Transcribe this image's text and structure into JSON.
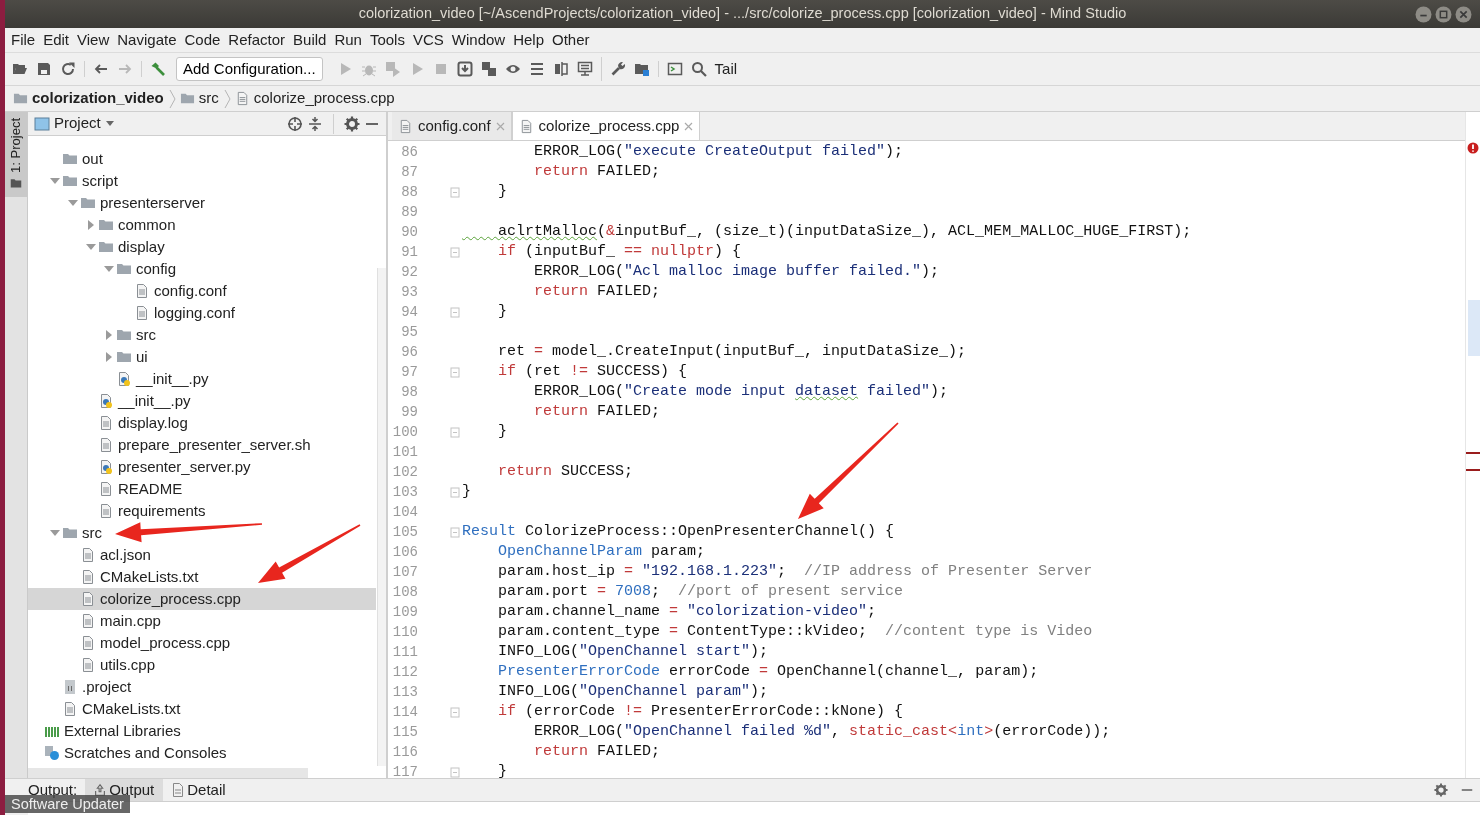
{
  "window": {
    "title": "colorization_video [~/AscendProjects/colorization_video] - .../src/colorize_process.cpp [colorization_video] - Mind Studio"
  },
  "menu": [
    "File",
    "Edit",
    "View",
    "Navigate",
    "Code",
    "Refactor",
    "Build",
    "Run",
    "Tools",
    "VCS",
    "Window",
    "Help",
    "Other"
  ],
  "toolbar": [
    [
      {
        "kind": "open",
        "disabled": false
      },
      {
        "kind": "save",
        "disabled": false
      },
      {
        "kind": "sync",
        "disabled": false
      }
    ],
    [
      {
        "kind": "back",
        "disabled": false
      },
      {
        "kind": "forward",
        "disabled": true
      }
    ],
    [
      {
        "kind": "build",
        "disabled": false
      },
      {
        "kind": "config",
        "label": "Add Configuration...",
        "disabled": false
      },
      {
        "kind": "run",
        "disabled": true
      },
      {
        "kind": "debug",
        "disabled": true
      },
      {
        "kind": "coverage",
        "disabled": true
      },
      {
        "kind": "run",
        "disabled": true
      },
      {
        "kind": "stop",
        "disabled": true
      },
      {
        "kind": "download",
        "disabled": false
      },
      {
        "kind": "squares",
        "disabled": false
      },
      {
        "kind": "eye",
        "disabled": false
      },
      {
        "kind": "list",
        "disabled": false
      },
      {
        "kind": "split",
        "disabled": false
      },
      {
        "kind": "monitor",
        "disabled": false
      }
    ],
    [
      {
        "kind": "wrench",
        "disabled": false
      },
      {
        "kind": "foldergrid",
        "disabled": false
      }
    ],
    [
      {
        "kind": "terminal",
        "disabled": false
      },
      {
        "kind": "search",
        "disabled": false
      },
      {
        "kind": "text",
        "label": "Tail",
        "disabled": false
      }
    ]
  ],
  "breadcrumb": [
    {
      "label": "colorization_video",
      "kind": "project"
    },
    {
      "label": "src",
      "kind": "folder"
    },
    {
      "label": "colorize_process.cpp",
      "kind": "file"
    }
  ],
  "side_tabs": [
    {
      "label": "1: Project",
      "selected": true
    }
  ],
  "project_panel": {
    "title": "Project",
    "tree": {
      "items": [
        {
          "label": "out",
          "kind": "folder",
          "selected": false
        },
        {
          "label": "script",
          "kind": "folder",
          "expanded": true,
          "selected": false,
          "children": [
            {
              "label": "presenterserver",
              "kind": "folder",
              "expanded": true,
              "selected": false,
              "children": [
                {
                  "label": "common",
                  "kind": "folder",
                  "expanded": false,
                  "selected": false
                },
                {
                  "label": "display",
                  "kind": "folder",
                  "expanded": true,
                  "selected": false,
                  "children": [
                    {
                      "label": "config",
                      "kind": "folder",
                      "expanded": true,
                      "selected": false,
                      "children": [
                        {
                          "label": "config.conf",
                          "kind": "file",
                          "selected": false
                        },
                        {
                          "label": "logging.conf",
                          "kind": "file",
                          "selected": false
                        }
                      ]
                    },
                    {
                      "label": "src",
                      "kind": "folder",
                      "expanded": false,
                      "selected": false
                    },
                    {
                      "label": "ui",
                      "kind": "folder",
                      "expanded": false,
                      "selected": false
                    },
                    {
                      "label": "__init__.py",
                      "kind": "python",
                      "selected": false
                    }
                  ]
                },
                {
                  "label": "__init__.py",
                  "kind": "python",
                  "selected": false
                },
                {
                  "label": "display.log",
                  "kind": "file",
                  "selected": false
                },
                {
                  "label": "prepare_presenter_server.sh",
                  "kind": "file",
                  "selected": false
                },
                {
                  "label": "presenter_server.py",
                  "kind": "python",
                  "selected": false
                },
                {
                  "label": "README",
                  "kind": "file",
                  "selected": false
                },
                {
                  "label": "requirements",
                  "kind": "file",
                  "selected": false
                }
              ]
            }
          ]
        },
        {
          "label": "src",
          "kind": "folder",
          "expanded": true,
          "selected": false,
          "children": [
            {
              "label": "acl.json",
              "kind": "file",
              "selected": false
            },
            {
              "label": "CMakeLists.txt",
              "kind": "file",
              "selected": false
            },
            {
              "label": "colorize_process.cpp",
              "kind": "file",
              "selected": true
            },
            {
              "label": "main.cpp",
              "kind": "file",
              "selected": false
            },
            {
              "label": "model_process.cpp",
              "kind": "file",
              "selected": false
            },
            {
              "label": "utils.cpp",
              "kind": "file",
              "selected": false
            }
          ]
        },
        {
          "label": ".project",
          "kind": "project",
          "selected": false
        },
        {
          "label": "CMakeLists.txt",
          "kind": "file",
          "selected": false
        }
      ],
      "roots": [
        {
          "label": "External Libraries",
          "kind": "libraries",
          "selected": false
        },
        {
          "label": "Scratches and Consoles",
          "kind": "scratches",
          "selected": false
        }
      ]
    }
  },
  "editor_tabs": [
    {
      "label": "config.conf",
      "selected": false
    },
    {
      "label": "colorize_process.cpp",
      "selected": true
    }
  ],
  "code": [
    {
      "number": "86",
      "fold": false,
      "segments": [
        {
          "kind": "plain",
          "text": "        ERROR_LOG("
        },
        {
          "kind": "string",
          "text": "\"execute CreateOutput failed\""
        },
        {
          "kind": "plain",
          "text": ");"
        }
      ]
    },
    {
      "number": "87",
      "fold": false,
      "segments": [
        {
          "kind": "keyword",
          "text": "        return"
        },
        {
          "kind": "plain",
          "text": " FAILED;"
        }
      ]
    },
    {
      "number": "88",
      "fold": true,
      "segments": [
        {
          "kind": "plain",
          "text": "    }"
        }
      ]
    },
    {
      "number": "89",
      "fold": false
    },
    {
      "number": "90",
      "fold": false,
      "segments": [
        {
          "kind": "spell",
          "text": "    aclrtMalloc"
        },
        {
          "kind": "plain",
          "text": "("
        },
        {
          "kind": "keyword",
          "text": "&"
        },
        {
          "kind": "plain",
          "text": "inputBuf_, (size_t)(inputDataSize_), ACL_MEM_MALLOC_HUGE_FIRST);"
        }
      ]
    },
    {
      "number": "91",
      "fold": true,
      "segments": [
        {
          "kind": "keyword",
          "text": "    if"
        },
        {
          "kind": "plain",
          "text": " (inputBuf_ "
        },
        {
          "kind": "keyword",
          "text": "== nullptr"
        },
        {
          "kind": "plain",
          "text": ") {"
        }
      ]
    },
    {
      "number": "92",
      "fold": false,
      "segments": [
        {
          "kind": "plain",
          "text": "        ERROR_LOG("
        },
        {
          "kind": "string",
          "text": "\"Acl malloc image buffer failed.\""
        },
        {
          "kind": "plain",
          "text": ");"
        }
      ]
    },
    {
      "number": "93",
      "fold": false,
      "segments": [
        {
          "kind": "keyword",
          "text": "        return"
        },
        {
          "kind": "plain",
          "text": " FAILED;"
        }
      ]
    },
    {
      "number": "94",
      "fold": true,
      "segments": [
        {
          "kind": "plain",
          "text": "    }"
        }
      ]
    },
    {
      "number": "95",
      "fold": false
    },
    {
      "number": "96",
      "fold": false,
      "segments": [
        {
          "kind": "plain",
          "text": "    ret "
        },
        {
          "kind": "keyword",
          "text": "="
        },
        {
          "kind": "plain",
          "text": " model_.CreateInput(inputBuf_, inputDataSize_);"
        }
      ]
    },
    {
      "number": "97",
      "fold": true,
      "segments": [
        {
          "kind": "keyword",
          "text": "    if"
        },
        {
          "kind": "plain",
          "text": " (ret "
        },
        {
          "kind": "keyword",
          "text": "!="
        },
        {
          "kind": "plain",
          "text": " SUCCESS) {"
        }
      ]
    },
    {
      "number": "98",
      "fold": false,
      "segments": [
        {
          "kind": "plain",
          "text": "        ERROR_LOG("
        },
        {
          "kind": "string",
          "text": "\"Create mode input "
        },
        {
          "kind": "string_spell",
          "text": "dataset"
        },
        {
          "kind": "string",
          "text": " failed\""
        },
        {
          "kind": "plain",
          "text": ");"
        }
      ]
    },
    {
      "number": "99",
      "fold": false,
      "segments": [
        {
          "kind": "keyword",
          "text": "        return"
        },
        {
          "kind": "plain",
          "text": " FAILED;"
        }
      ]
    },
    {
      "number": "100",
      "fold": true,
      "segments": [
        {
          "kind": "plain",
          "text": "    }"
        }
      ]
    },
    {
      "number": "101",
      "fold": false
    },
    {
      "number": "102",
      "fold": false,
      "segments": [
        {
          "kind": "keyword",
          "text": "    return"
        },
        {
          "kind": "plain",
          "text": " SUCCESS;"
        }
      ]
    },
    {
      "number": "103",
      "fold": true,
      "segments": [
        {
          "kind": "plain",
          "text": "}"
        }
      ]
    },
    {
      "number": "104",
      "fold": false
    },
    {
      "number": "105",
      "fold": true,
      "segments": [
        {
          "kind": "type",
          "text": "Result"
        },
        {
          "kind": "plain",
          "text": " ColorizeProcess::OpenPresenterChannel() {"
        }
      ]
    },
    {
      "number": "106",
      "fold": false,
      "segments": [
        {
          "kind": "type",
          "text": "    OpenChannelParam"
        },
        {
          "kind": "plain",
          "text": " param;"
        }
      ]
    },
    {
      "number": "107",
      "fold": false,
      "segments": [
        {
          "kind": "plain",
          "text": "    param.host_ip "
        },
        {
          "kind": "keyword",
          "text": "= "
        },
        {
          "kind": "string",
          "text": "\"192.168.1.223\""
        },
        {
          "kind": "plain",
          "text": ";  "
        },
        {
          "kind": "comment",
          "text": "//IP address of Presenter Server"
        }
      ]
    },
    {
      "number": "108",
      "fold": false,
      "segments": [
        {
          "kind": "plain",
          "text": "    param.port "
        },
        {
          "kind": "keyword",
          "text": "= "
        },
        {
          "kind": "number",
          "text": "7008"
        },
        {
          "kind": "plain",
          "text": ";  "
        },
        {
          "kind": "comment",
          "text": "//port of present service"
        }
      ]
    },
    {
      "number": "109",
      "fold": false,
      "segments": [
        {
          "kind": "plain",
          "text": "    param.channel_name "
        },
        {
          "kind": "keyword",
          "text": "= "
        },
        {
          "kind": "string",
          "text": "\"colorization-video\""
        },
        {
          "kind": "plain",
          "text": ";"
        }
      ]
    },
    {
      "number": "110",
      "fold": false,
      "segments": [
        {
          "kind": "plain",
          "text": "    param.content_type "
        },
        {
          "kind": "keyword",
          "text": "="
        },
        {
          "kind": "plain",
          "text": " ContentType::kVideo;  "
        },
        {
          "kind": "comment",
          "text": "//content type is Video"
        }
      ]
    },
    {
      "number": "111",
      "fold": false,
      "segments": [
        {
          "kind": "plain",
          "text": "    INFO_LOG("
        },
        {
          "kind": "string",
          "text": "\"OpenChannel start\""
        },
        {
          "kind": "plain",
          "text": ");"
        }
      ]
    },
    {
      "number": "112",
      "fold": false,
      "segments": [
        {
          "kind": "type",
          "text": "    PresenterErrorCode"
        },
        {
          "kind": "plain",
          "text": " errorCode "
        },
        {
          "kind": "keyword",
          "text": "="
        },
        {
          "kind": "plain",
          "text": " OpenChannel(channel_, param);"
        }
      ]
    },
    {
      "number": "113",
      "fold": false,
      "segments": [
        {
          "kind": "plain",
          "text": "    INFO_LOG("
        },
        {
          "kind": "string",
          "text": "\"OpenChannel param\""
        },
        {
          "kind": "plain",
          "text": ");"
        }
      ]
    },
    {
      "number": "114",
      "fold": true,
      "segments": [
        {
          "kind": "keyword",
          "text": "    if"
        },
        {
          "kind": "plain",
          "text": " (errorCode "
        },
        {
          "kind": "keyword",
          "text": "!="
        },
        {
          "kind": "plain",
          "text": " PresenterErrorCode::kNone) {"
        }
      ]
    },
    {
      "number": "115",
      "fold": false,
      "segments": [
        {
          "kind": "plain",
          "text": "        ERROR_LOG("
        },
        {
          "kind": "string",
          "text": "\"OpenChannel failed %d\""
        },
        {
          "kind": "plain",
          "text": ", "
        },
        {
          "kind": "keyword",
          "text": "static_cast<"
        },
        {
          "kind": "type",
          "text": "int"
        },
        {
          "kind": "keyword",
          "text": ">"
        },
        {
          "kind": "plain",
          "text": "(errorCode));"
        }
      ]
    },
    {
      "number": "116",
      "fold": false,
      "segments": [
        {
          "kind": "keyword",
          "text": "        return"
        },
        {
          "kind": "plain",
          "text": " FAILED;"
        }
      ]
    },
    {
      "number": "117",
      "fold": true,
      "segments": [
        {
          "kind": "plain",
          "text": "    }"
        }
      ]
    }
  ],
  "output_bar": {
    "label": "Output:",
    "tabs": [
      {
        "label": "Output",
        "kind": "output",
        "selected": true
      },
      {
        "label": "Detail",
        "kind": "detail",
        "selected": false
      }
    ]
  },
  "tooltip": {
    "text": "Software Updater"
  }
}
